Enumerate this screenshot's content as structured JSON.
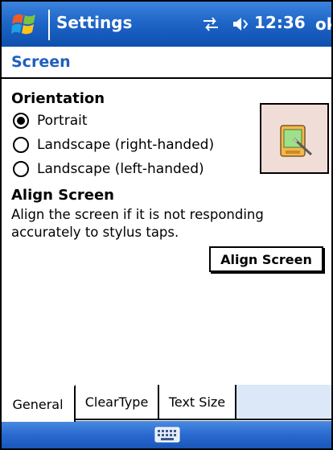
{
  "titlebar": {
    "app_title": "Settings",
    "time": "12:36",
    "ok_label": "ok",
    "connectivity_icon": "connectivity-icon",
    "volume_icon": "volume-icon",
    "start_icon": "windows-flag-icon"
  },
  "page": {
    "title": "Screen"
  },
  "orientation": {
    "heading": "Orientation",
    "options": [
      {
        "label": "Portrait",
        "selected": true
      },
      {
        "label": "Landscape (right-handed)",
        "selected": false
      },
      {
        "label": "Landscape (left-handed)",
        "selected": false
      }
    ],
    "preview_icon": "device-stylus-icon"
  },
  "align": {
    "heading": "Align Screen",
    "description": "Align the screen if it is not responding accurately to stylus taps.",
    "button_label": "Align Screen"
  },
  "tabs": [
    {
      "label": "General",
      "active": true
    },
    {
      "label": "ClearType",
      "active": false
    },
    {
      "label": "Text Size",
      "active": false
    }
  ],
  "menubar": {
    "input_icon": "keyboard-icon"
  },
  "colors": {
    "titlebar_blue": "#1f66c8",
    "header_text_blue": "#1f5fbf",
    "preview_bg": "#f1ddd8"
  }
}
